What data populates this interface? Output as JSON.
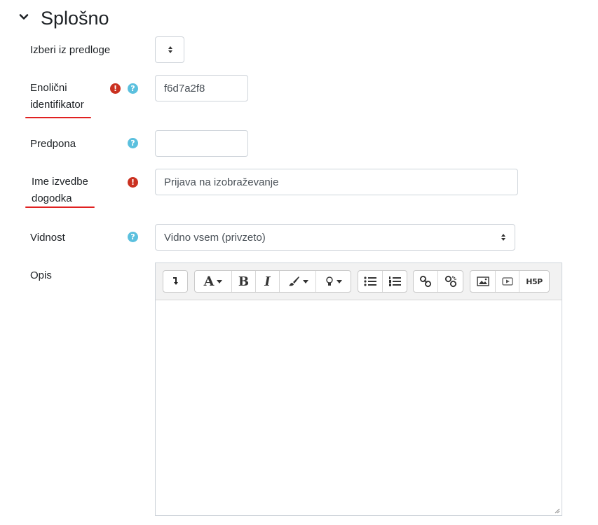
{
  "section": {
    "title": "Splošno",
    "toggle_icon": "chevron-down-icon"
  },
  "fields": {
    "template": {
      "label": "Izberi iz predloge",
      "value": ""
    },
    "identifier": {
      "label_line1": "Enolični",
      "label_line2": "identifikator",
      "value": "f6d7a2f8",
      "required": true,
      "help": true
    },
    "prefix": {
      "label": "Predpona",
      "value": "",
      "help": true
    },
    "event_name": {
      "label_line1": "Ime izvedbe",
      "label_line2": "dogodka",
      "value": "Prijava na izobraževanje",
      "required": true
    },
    "visibility": {
      "label": "Vidnost",
      "value": "Vidno vsem (privzeto)",
      "help": true
    },
    "description": {
      "label": "Opis",
      "value": ""
    }
  },
  "editor_toolbar": {
    "groups": [
      [
        "toggle-toolbar-icon"
      ],
      [
        "font-style-icon",
        "bold-icon",
        "italic-icon",
        "text-color-icon",
        "bulb-icon"
      ],
      [
        "unordered-list-icon",
        "ordered-list-icon"
      ],
      [
        "link-icon",
        "unlink-icon"
      ],
      [
        "image-icon",
        "media-icon",
        "h5p-icon"
      ]
    ],
    "labels": {
      "font": "A",
      "bold": "B",
      "italic": "I",
      "h5p": "H5P"
    }
  },
  "colors": {
    "required": "#ca3120",
    "help": "#5bc0de",
    "underline": "#e02121",
    "border": "#ced4da"
  }
}
